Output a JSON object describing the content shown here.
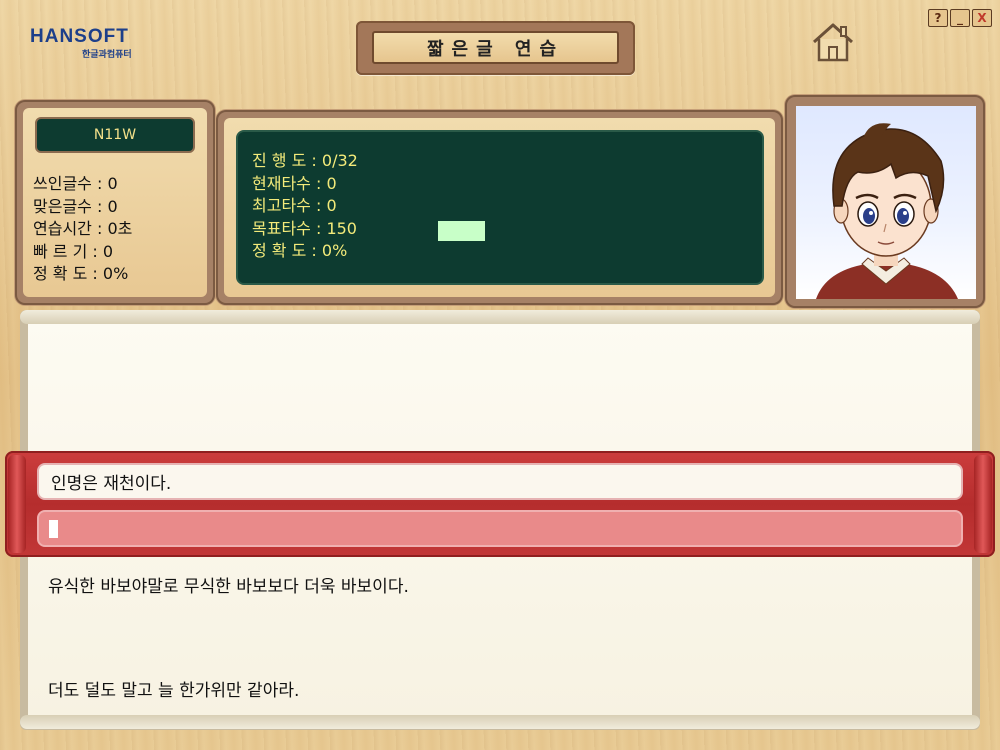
{
  "app": {
    "logo_main": "HANSOFT",
    "logo_sub": "한글과컴퓨터",
    "title": "짧은글 연습"
  },
  "window_buttons": {
    "help": "?",
    "minimize": "_",
    "close": "X"
  },
  "user": {
    "name": "N11W"
  },
  "left_stats": {
    "chars_typed": "쓰인글수 : 0",
    "chars_correct": "맞은글수 : 0",
    "practice_time": "연습시간 : 0초",
    "speed": "빠 르 기 : 0",
    "accuracy": "정 확 도 : 0%"
  },
  "board": {
    "progress": "진 행 도 :  0/32",
    "current_speed": "현재타수 : 0",
    "best_speed": "최고타수 : 0",
    "target_speed": "목표타수 : 150",
    "accuracy": "정 확 도 : 0%",
    "target_color": "#c8ffc8"
  },
  "practice": {
    "current_sentence": "인명은 재천이다.",
    "input_value": "",
    "next_sentences": [
      "유식한 바보야말로 무식한 바보보다 더욱 바보이다.",
      "더도 덜도 말고 늘 한가위만 같아라."
    ]
  },
  "colors": {
    "board_bg": "#0d3b30",
    "board_text": "#f3ea7a",
    "band_red": "#c23737",
    "input_bg": "#e98a8a"
  },
  "icons": {
    "home": "home-icon",
    "character": "character-portrait"
  }
}
